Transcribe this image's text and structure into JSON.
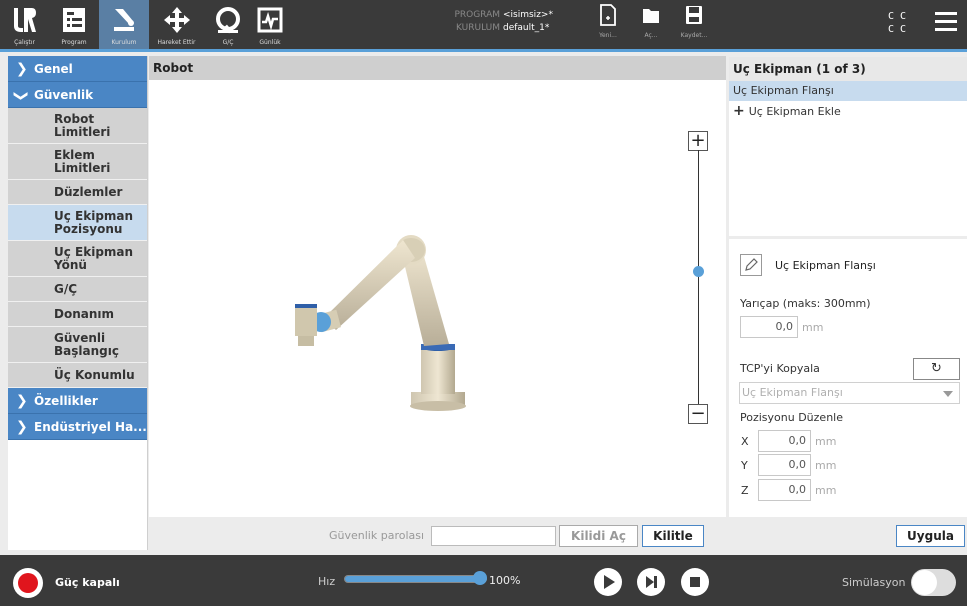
{
  "topbar": {
    "nav": [
      {
        "id": "run",
        "label": "Çalıştır",
        "icon": "ur-logo-icon"
      },
      {
        "id": "program",
        "label": "Program",
        "icon": "program-icon"
      },
      {
        "id": "installation",
        "label": "Kurulum",
        "icon": "installation-icon",
        "active": true
      },
      {
        "id": "move",
        "label": "Hareket Ettir",
        "icon": "move-icon"
      },
      {
        "id": "io",
        "label": "G/Ç",
        "icon": "io-icon"
      },
      {
        "id": "log",
        "label": "Günlük",
        "icon": "log-icon"
      }
    ],
    "program_key": "PROGRAM",
    "program_value": "<isimsiz>*",
    "installation_key": "KURULUM",
    "installation_value": "default_1*",
    "file_buttons": [
      {
        "id": "new",
        "label": "Yeni..."
      },
      {
        "id": "open",
        "label": "Aç..."
      },
      {
        "id": "save",
        "label": "Kaydet..."
      }
    ],
    "status_top": "C C",
    "status_bottom": "C C"
  },
  "leftnav": {
    "general": "Genel",
    "safety": "Güvenlik",
    "safety_items": [
      {
        "label": "Robot Limitleri",
        "two_line": true
      },
      {
        "label": "Eklem Limitleri",
        "two_line": true
      },
      {
        "label": "Düzlemler",
        "two_line": false
      },
      {
        "label": "Uç Ekipman Pozisyonu",
        "two_line": true,
        "selected": true
      },
      {
        "label": "Uç Ekipman Yönü",
        "two_line": true
      },
      {
        "label": "G/Ç",
        "two_line": false
      },
      {
        "label": "Donanım",
        "two_line": false
      },
      {
        "label": "Güvenli Başlangıç",
        "two_line": true
      },
      {
        "label": "Üç Konumlu",
        "two_line": false
      }
    ],
    "features": "Özellikler",
    "industrial": "Endüstriyel Ha..."
  },
  "center": {
    "title": "Robot",
    "zoom_in": "+",
    "zoom_out": "−"
  },
  "right": {
    "title": "Uç Ekipman (1 of 3)",
    "tcp_selected": "Uç Ekipman Flanşı",
    "add_tcp": "Uç Ekipman Ekle",
    "edit_name": "Uç Ekipman Flanşı",
    "radius_label": "Yarıçap (maks: 300mm)",
    "radius_value": "0,0",
    "unit_mm": "mm",
    "copy_tcp_label": "TCP'yi Kopyala",
    "copy_tcp_dropdown": "Uç Ekipman Flanşı",
    "edit_position_label": "Pozisyonu Düzenle",
    "x_label": "X",
    "x_value": "0,0",
    "y_label": "Y",
    "y_value": "0,0",
    "z_label": "Z",
    "z_value": "0,0"
  },
  "actionbar": {
    "password_label": "Güvenlik parolası",
    "password_value": "",
    "unlock": "Kilidi Aç",
    "lock": "Kilitle",
    "apply": "Uygula"
  },
  "footer": {
    "power": "Güç kapalı",
    "speed_label": "Hız",
    "speed_value": "100%",
    "speed_fraction": 1.0,
    "simulation": "Simülasyon"
  },
  "colors": {
    "accent": "#5aa0d8",
    "nav_blue": "#4a86c5",
    "selected": "#c7dbee",
    "power_red": "#e0151d"
  }
}
